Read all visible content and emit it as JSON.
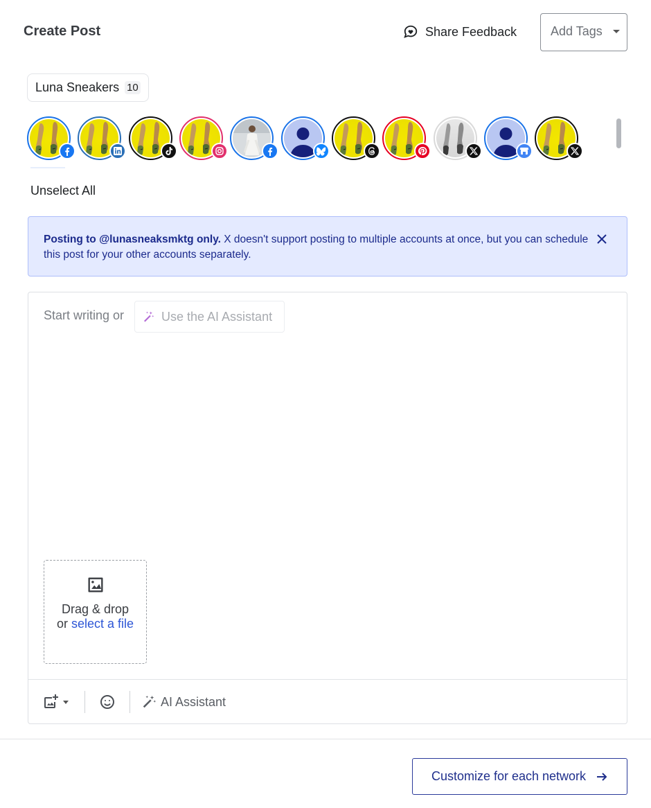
{
  "header": {
    "title": "Create Post",
    "feedback_label": "Share Feedback",
    "tags_placeholder": "Add Tags"
  },
  "group": {
    "name": "Luna Sneakers",
    "count": "10"
  },
  "accounts": [
    {
      "photo": "sneaker-yellow",
      "network": "facebook",
      "ring": "#1a73e8"
    },
    {
      "photo": "sneaker-yellow",
      "network": "linkedin",
      "ring": "#2a6fb7"
    },
    {
      "photo": "sneaker-yellow",
      "network": "tiktok",
      "ring": "#111111"
    },
    {
      "photo": "sneaker-yellow",
      "network": "instagram",
      "ring": "#e1306c"
    },
    {
      "photo": "person-photo",
      "network": "facebook",
      "ring": "#1a73e8"
    },
    {
      "photo": "default-avatar",
      "network": "bluesky",
      "ring": "#1a73e8"
    },
    {
      "photo": "sneaker-yellow",
      "network": "threads",
      "ring": "#111111"
    },
    {
      "photo": "sneaker-yellow",
      "network": "pinterest",
      "ring": "#e60023"
    },
    {
      "photo": "sneaker-grey",
      "network": "x",
      "ring": "#d9d9d9"
    },
    {
      "photo": "default-avatar",
      "network": "google-business",
      "ring": "#1a73e8"
    },
    {
      "photo": "sneaker-yellow",
      "network": "x",
      "ring": "#111111"
    }
  ],
  "unselect_all": "Unselect All",
  "notice": {
    "bold": "Posting to @lunasneaksmktg only.",
    "text": " X doesn't support posting to multiple accounts at once, but you can schedule this post for your other accounts separately."
  },
  "editor": {
    "placeholder": "Start writing or",
    "ai_chip": "Use the AI Assistant",
    "drop_line1": "Drag & drop",
    "drop_or": "or ",
    "drop_link": "select a file"
  },
  "toolbar": {
    "ai_label": "AI Assistant"
  },
  "footer": {
    "customize_label": "Customize for each network"
  },
  "colors": {
    "accent": "#1f2f8c",
    "notice_bg": "#e4eaff",
    "link": "#2d56d6"
  }
}
